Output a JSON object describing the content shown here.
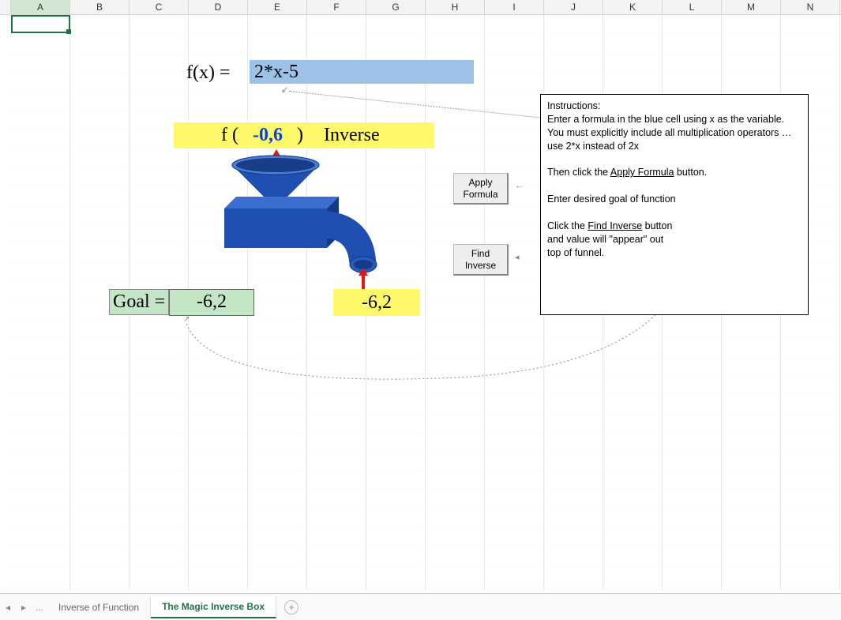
{
  "columns": [
    "A",
    "B",
    "C",
    "D",
    "E",
    "F",
    "G",
    "H",
    "I",
    "J",
    "K",
    "L",
    "M",
    "N"
  ],
  "rows_visible": 30,
  "selected_cell": "A1",
  "fx": {
    "label": "f(x)  =",
    "formula": "2*x-5"
  },
  "banner": {
    "f_open": "f (",
    "value": "-0,6",
    "f_close": ")",
    "inverse_label": "Inverse"
  },
  "goal": {
    "label": "Goal =",
    "value": "-6,2",
    "output": "-6,2"
  },
  "buttons": {
    "apply": "Apply Formula",
    "find": "Find Inverse"
  },
  "instructions": {
    "title": "Instructions:",
    "p1": "Enter a formula in the blue cell using x as the variable.  You must explicitly include all multiplication operators … use 2*x  instead of 2x",
    "p2a": "Then click the ",
    "p2u": "Apply Formula",
    "p2b": " button.",
    "p3": "Enter desired goal of function",
    "p4a": "Click the ",
    "p4u": "Find Inverse",
    "p5": " button and value will \"appear\" out top of funnel."
  },
  "tabs": {
    "prev": "◂",
    "next": "▸",
    "more": "...",
    "sheet1": "Inverse of Function",
    "sheet2": "The Magic Inverse Box",
    "add": "+"
  }
}
